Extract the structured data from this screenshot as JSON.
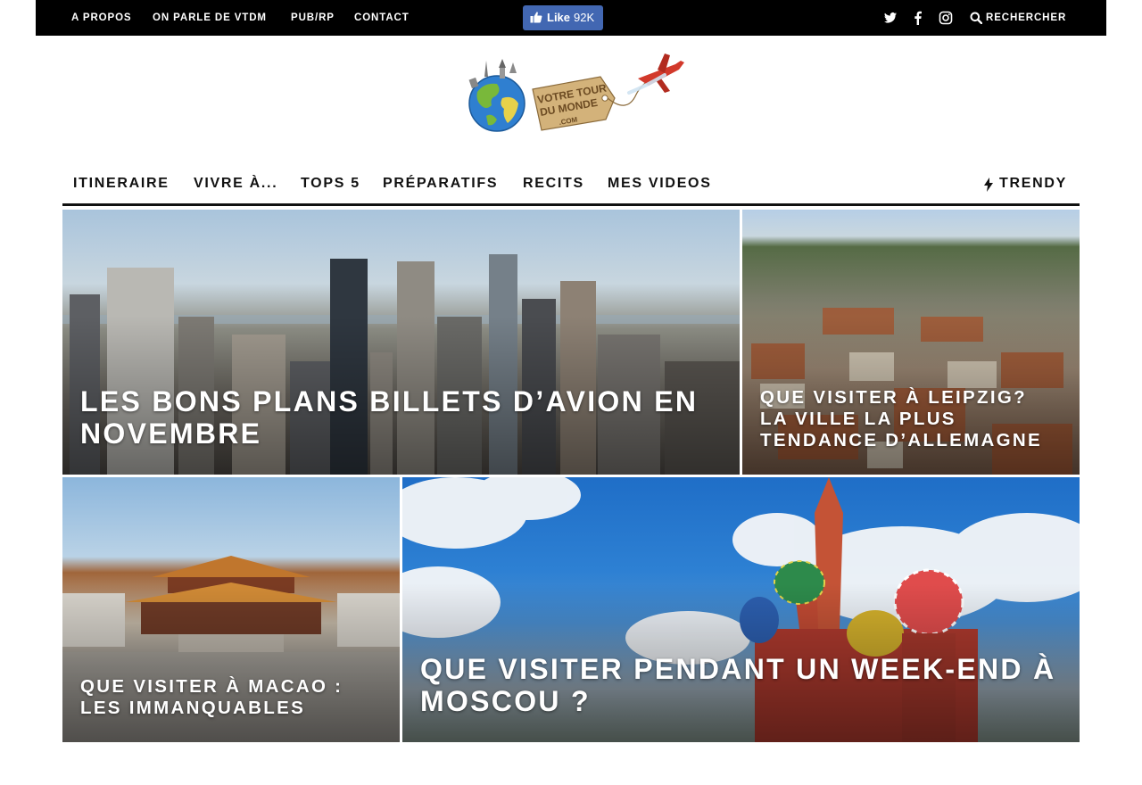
{
  "topbar": {
    "links": [
      "A PROPOS",
      "ON PARLE DE VTDM",
      "PUB/RP",
      "CONTACT"
    ],
    "facebook": {
      "label": "Like",
      "count": "92K"
    },
    "social_icons": [
      "twitter-icon",
      "facebook-icon",
      "instagram-icon"
    ],
    "search_label": "RECHERCHER"
  },
  "logo": {
    "line1": "VOTRE TOUR",
    "line2": "DU MONDE",
    "line3": ".COM"
  },
  "nav": {
    "items": [
      "ITINERAIRE",
      "VIVRE À...",
      "TOPS 5",
      "PRÉPARATIFS",
      "RECITS",
      "MES VIDEOS"
    ],
    "trendy": "TRENDY"
  },
  "featured": [
    {
      "title": "LES BONS PLANS BILLETS D’AVION EN NOVEMBRE"
    },
    {
      "title": "QUE VISITER À LEIPZIG? LA VILLE LA PLUS TENDANCE D’ALLEMAGNE"
    },
    {
      "title": "QUE VISITER À MACAO : LES IMMANQUABLES"
    },
    {
      "title": "QUE VISITER PENDANT UN WEEK-END À MOSCOU ?"
    }
  ],
  "colors": {
    "topbar": "#000000",
    "facebook": "#4267b2",
    "nav_text": "#111111"
  }
}
